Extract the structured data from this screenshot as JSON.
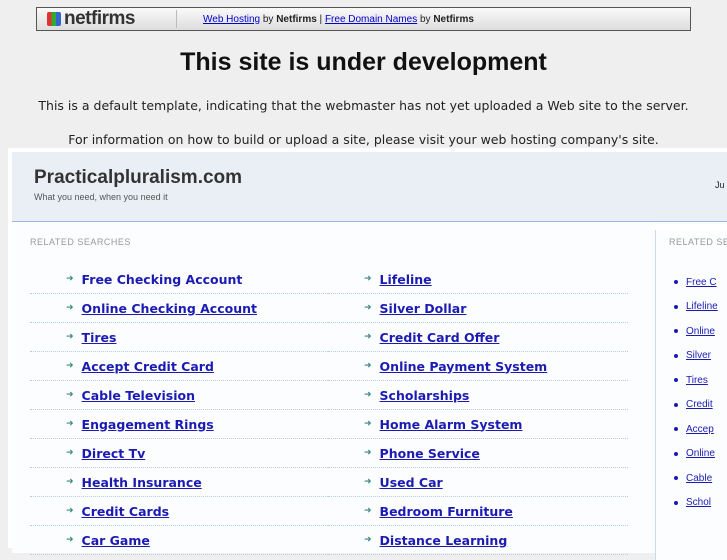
{
  "banner": {
    "logo": "netfirms",
    "link1": "Web Hosting",
    "by1": " by ",
    "brand1": "Netfirms",
    "sep": " | ",
    "link2": "Free Domain Names",
    "by2": " by ",
    "brand2": "Netfirms"
  },
  "title": "This site is under development",
  "para1": "This is a default template, indicating that the webmaster has not yet uploaded a Web site to the server.",
  "para2": "For information on how to build or upload a site, please visit your web hosting company's site.",
  "parked": {
    "site": "Practicalpluralism.com",
    "tagline": "What you need, when you need it",
    "date": "Ju",
    "related_label": "RELATED SEARCHES",
    "side_label": "RELATED SEA",
    "left": [
      "Free Checking Account",
      "Online Checking Account",
      "Tires",
      "Accept Credit Card",
      "Cable Television",
      "Engagement Rings",
      "Direct Tv",
      "Health Insurance",
      "Credit Cards",
      "Car Game"
    ],
    "right": [
      "Lifeline",
      "Silver Dollar",
      "Credit Card Offer",
      "Online Payment System",
      "Scholarships",
      "Home Alarm System",
      "Phone Service",
      "Used Car",
      "Bedroom Furniture",
      "Distance Learning"
    ],
    "side": [
      "Free C",
      "Lifeline",
      "Online",
      "Silver",
      "Tires",
      "Credit",
      "Accep",
      "Online",
      "Cable",
      "Schol"
    ]
  }
}
